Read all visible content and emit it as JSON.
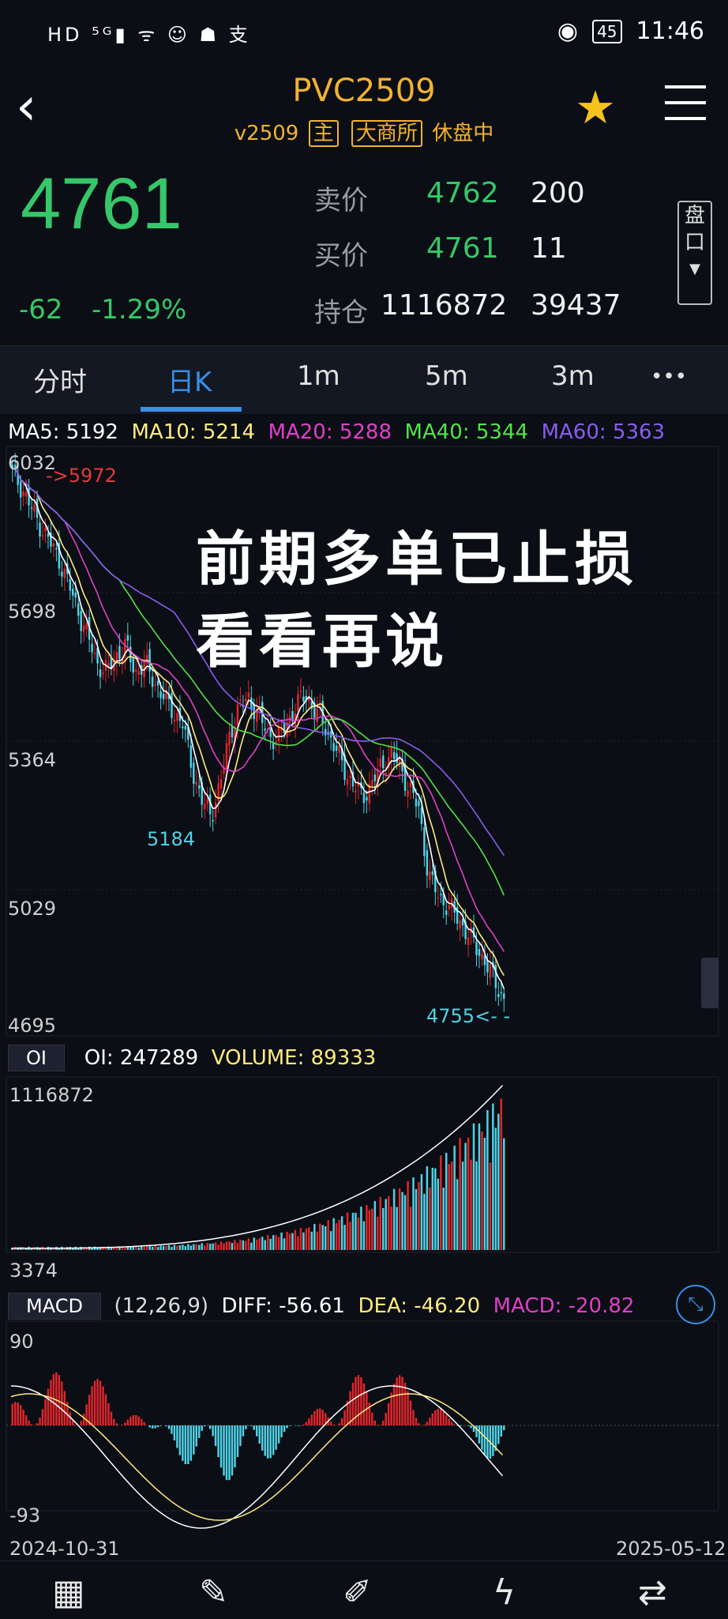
{
  "status": {
    "left_icons": "HD ⁵ᴳ▮ ᯤ ☺ ☗ 支",
    "battery": "45",
    "time": "11:46"
  },
  "header": {
    "title": "PVC2509",
    "contract": "v2509",
    "tag_main": "主",
    "tag_exchange": "大商所",
    "state": "休盘中",
    "back_icon": "chevron-left-icon",
    "fav_icon": "star-icon",
    "menu_icon": "menu-icon"
  },
  "quote": {
    "last": "4761",
    "change": "-62",
    "change_pct": "-1.29%",
    "ask_label": "卖价",
    "ask_price": "4762",
    "ask_vol": "200",
    "bid_label": "买价",
    "bid_price": "4761",
    "bid_vol": "11",
    "oi_label": "持仓",
    "oi": "1116872",
    "oi_chg": "39437",
    "pan_label_1": "盘",
    "pan_label_2": "口"
  },
  "tabs": [
    {
      "label": "分时"
    },
    {
      "label": "日K"
    },
    {
      "label": "1m"
    },
    {
      "label": "5m"
    },
    {
      "label": "3m"
    },
    {
      "label": "•••"
    }
  ],
  "ma": {
    "ma5": "MA5: 5192",
    "ma10": "MA10: 5214",
    "ma20": "MA20: 5288",
    "ma40": "MA40: 5344",
    "ma60": "MA60: 5363"
  },
  "kline": {
    "y_ticks": [
      "6032",
      "5698",
      "5364",
      "5029",
      "4695"
    ],
    "high_marker": "->5972",
    "low_marker": "5184",
    "last_marker": "4755<- -",
    "overlay_line1": "前期多单已止损",
    "overlay_line2": "看看再说",
    "colors": {
      "up": "#e0262b",
      "down": "#4fd2e6",
      "ma5": "#ffffff",
      "ma10": "#ffeb80",
      "ma20": "#e040c8",
      "ma40": "#52e34a",
      "ma60": "#8a5cf0"
    }
  },
  "oi_panel": {
    "btn": "OI",
    "oi_text": "OI: 247289",
    "volume_text": "VOLUME: 89333",
    "y_top": "1116872",
    "y_bottom": "3374"
  },
  "macd_panel": {
    "btn": "MACD",
    "params": "(12,26,9)",
    "diff": "DIFF: -56.61",
    "dea": "DEA: -46.20",
    "macd": "MACD: -20.82",
    "y_top": "90",
    "y_bottom": "-93",
    "date_start": "2024-10-31",
    "date_end": "2025-05-12"
  },
  "bottom_icons": [
    "grid-icon",
    "pen-icon",
    "draw-icon",
    "flash-icon",
    "switch-icon"
  ],
  "chart_data": {
    "type": "candlestick",
    "x_range": [
      "2024-10-31",
      "2025-05-12"
    ],
    "y_range": [
      4695,
      6032
    ],
    "ohlc_close_trend": [
      5980,
      5950,
      5900,
      5860,
      5820,
      5780,
      5720,
      5660,
      5600,
      5540,
      5520,
      5560,
      5580,
      5520,
      5540,
      5500,
      5460,
      5430,
      5400,
      5300,
      5220,
      5190,
      5260,
      5380,
      5440,
      5460,
      5420,
      5380,
      5360,
      5400,
      5440,
      5470,
      5430,
      5400,
      5350,
      5300,
      5260,
      5230,
      5260,
      5300,
      5330,
      5300,
      5250,
      5200,
      5050,
      5000,
      4980,
      4950,
      4920,
      4880,
      4850,
      4800,
      4761
    ],
    "lows": {
      "min": 5184,
      "last": 4755
    },
    "high": 5972
  }
}
